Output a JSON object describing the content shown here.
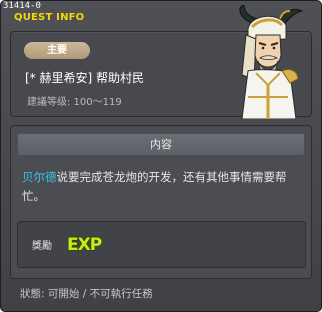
{
  "window": {
    "quest_id": "31414-0",
    "title": "QUEST INFO"
  },
  "quest": {
    "type_badge": "主要",
    "name": "[* 赫里希安] 帮助村民",
    "level_requirement": "建議等级: 100～119"
  },
  "content": {
    "header": "内容",
    "npc_name": "贝尔德",
    "description": "说要完成苍龙炮的开发，还有其他事情需要帮忙。",
    "reward_label": "獎勵",
    "reward_icon": "exp-icon",
    "reward_text": "EXP"
  },
  "status": "狀態: 可開始 / 不可執行任務",
  "colors": {
    "title": "#f5d800",
    "npc_link": "#38c8e8",
    "badge": "#c4ae8e",
    "exp_fill": "#c7ec1a"
  }
}
